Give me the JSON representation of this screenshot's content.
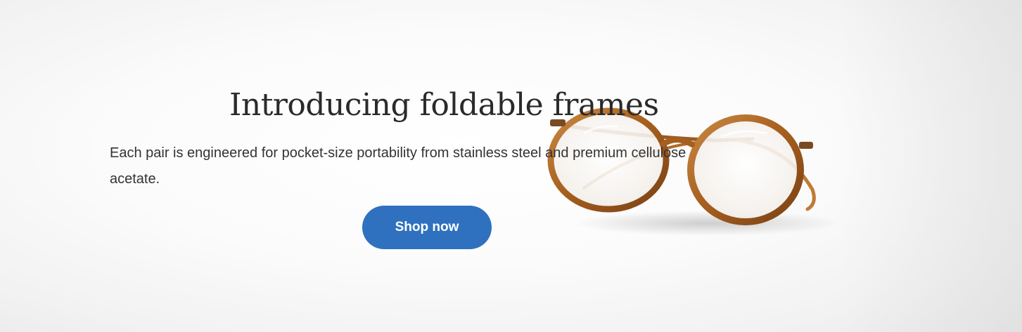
{
  "hero": {
    "headline": "Introducing foldable frames",
    "description": "Each pair is engineered for pocket-size portability from stainless steel and premium cellulose acetate.",
    "cta_label": "Shop now",
    "image": "tortoiseshell-eyeglasses"
  },
  "colors": {
    "cta_background": "#2f71bf",
    "cta_text": "#ffffff",
    "headline_text": "#2a2a2a",
    "body_text": "#333333",
    "frame_amber": "#b8702e",
    "frame_dark": "#6b3a14"
  }
}
